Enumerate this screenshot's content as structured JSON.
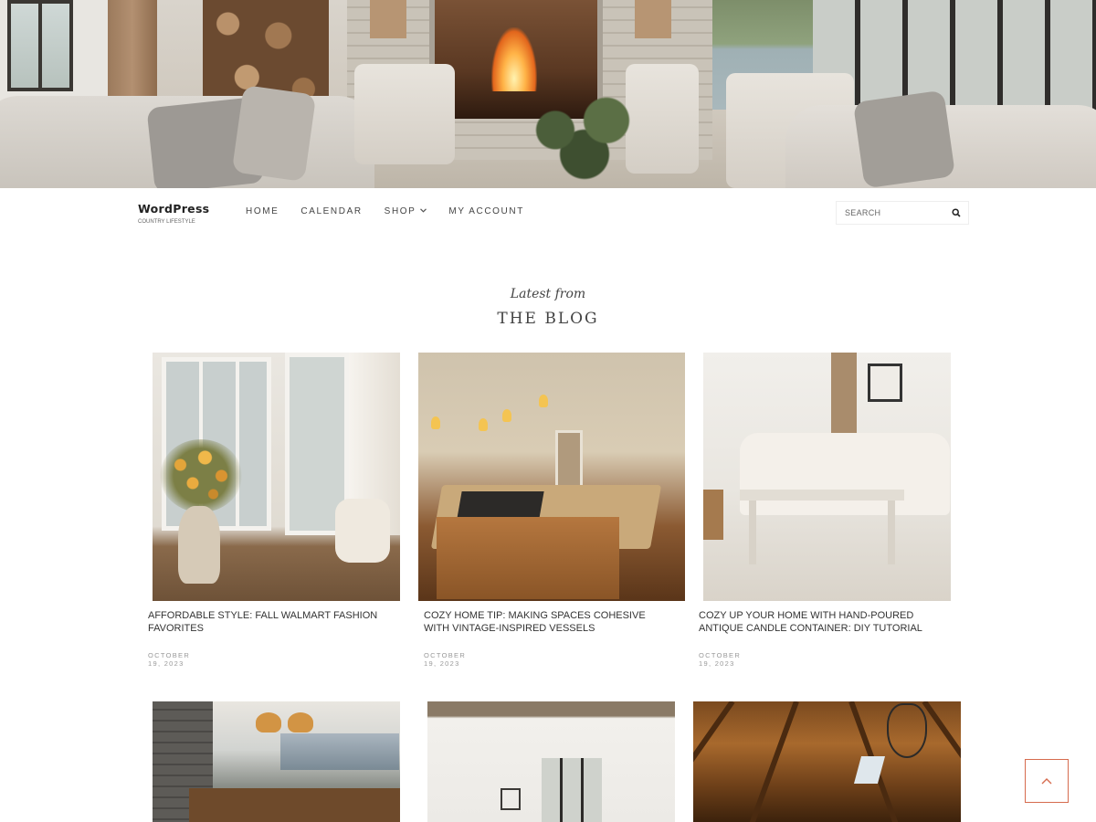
{
  "site": {
    "name": "WordPress",
    "tagline": "COUNTRY LIFESTYLE"
  },
  "nav": {
    "items": [
      {
        "label": "HOME"
      },
      {
        "label": "CALENDAR"
      },
      {
        "label": "SHOP",
        "has_dropdown": true
      },
      {
        "label": "MY ACCOUNT"
      }
    ]
  },
  "search": {
    "placeholder": "SEARCH",
    "icon": "search-icon"
  },
  "blog": {
    "subtitle": "Latest from",
    "title": "THE BLOG",
    "posts": [
      {
        "title": "AFFORDABLE STYLE: FALL WALMART FASHION FAVORITES",
        "date": "OCTOBER 19, 2023"
      },
      {
        "title": "COZY HOME TIP: MAKING SPACES COHESIVE WITH VINTAGE-INSPIRED VESSELS",
        "date": "OCTOBER 19, 2023"
      },
      {
        "title": "COZY UP YOUR HOME WITH HAND-POURED ANTIQUE CANDLE CONTAINER: DIY TUTORIAL",
        "date": "OCTOBER 19, 2023"
      }
    ]
  },
  "back_to_top": {
    "icon": "chevron-up-icon"
  },
  "colors": {
    "accent": "#d66b4e",
    "text": "#333333",
    "muted": "#999999"
  }
}
